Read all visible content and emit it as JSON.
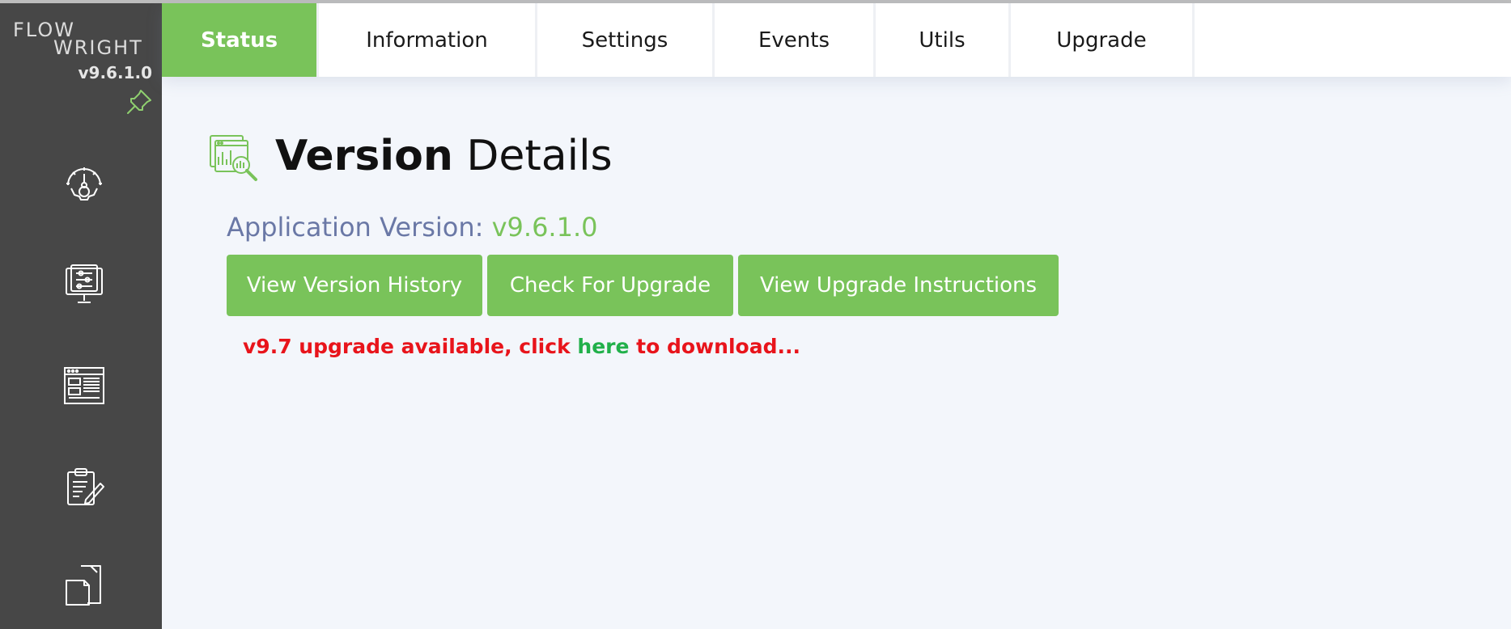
{
  "sidebar": {
    "logo_line1": "FLOW",
    "logo_line2": "WRIGHT",
    "version": "v9.6.1.0",
    "icons": [
      "pin-icon",
      "dashboard-gear-icon",
      "monitor-settings-icon",
      "webpage-layout-icon",
      "clipboard-edit-icon",
      "documents-icon"
    ]
  },
  "tabs": [
    {
      "label": "Status",
      "active": true
    },
    {
      "label": "Information",
      "active": false
    },
    {
      "label": "Settings",
      "active": false
    },
    {
      "label": "Events",
      "active": false
    },
    {
      "label": "Utils",
      "active": false
    },
    {
      "label": "Upgrade",
      "active": false
    }
  ],
  "content": {
    "title_bold": "Version",
    "title_rest": " Details",
    "app_version_label": "Application Version: ",
    "app_version_value": "v9.6.1.0",
    "buttons": {
      "history": "View Version History",
      "check": "Check For Upgrade",
      "instructions": "View Upgrade Instructions"
    },
    "upgrade_message": {
      "prefix": "v9.7 upgrade available, click ",
      "link": "here",
      "suffix": " to download..."
    }
  },
  "colors": {
    "accent_green": "#79c35a",
    "sidebar_bg": "#474747",
    "alert_red": "#e8141b",
    "link_green": "#21b04a",
    "label_blue": "#6a78a6"
  }
}
